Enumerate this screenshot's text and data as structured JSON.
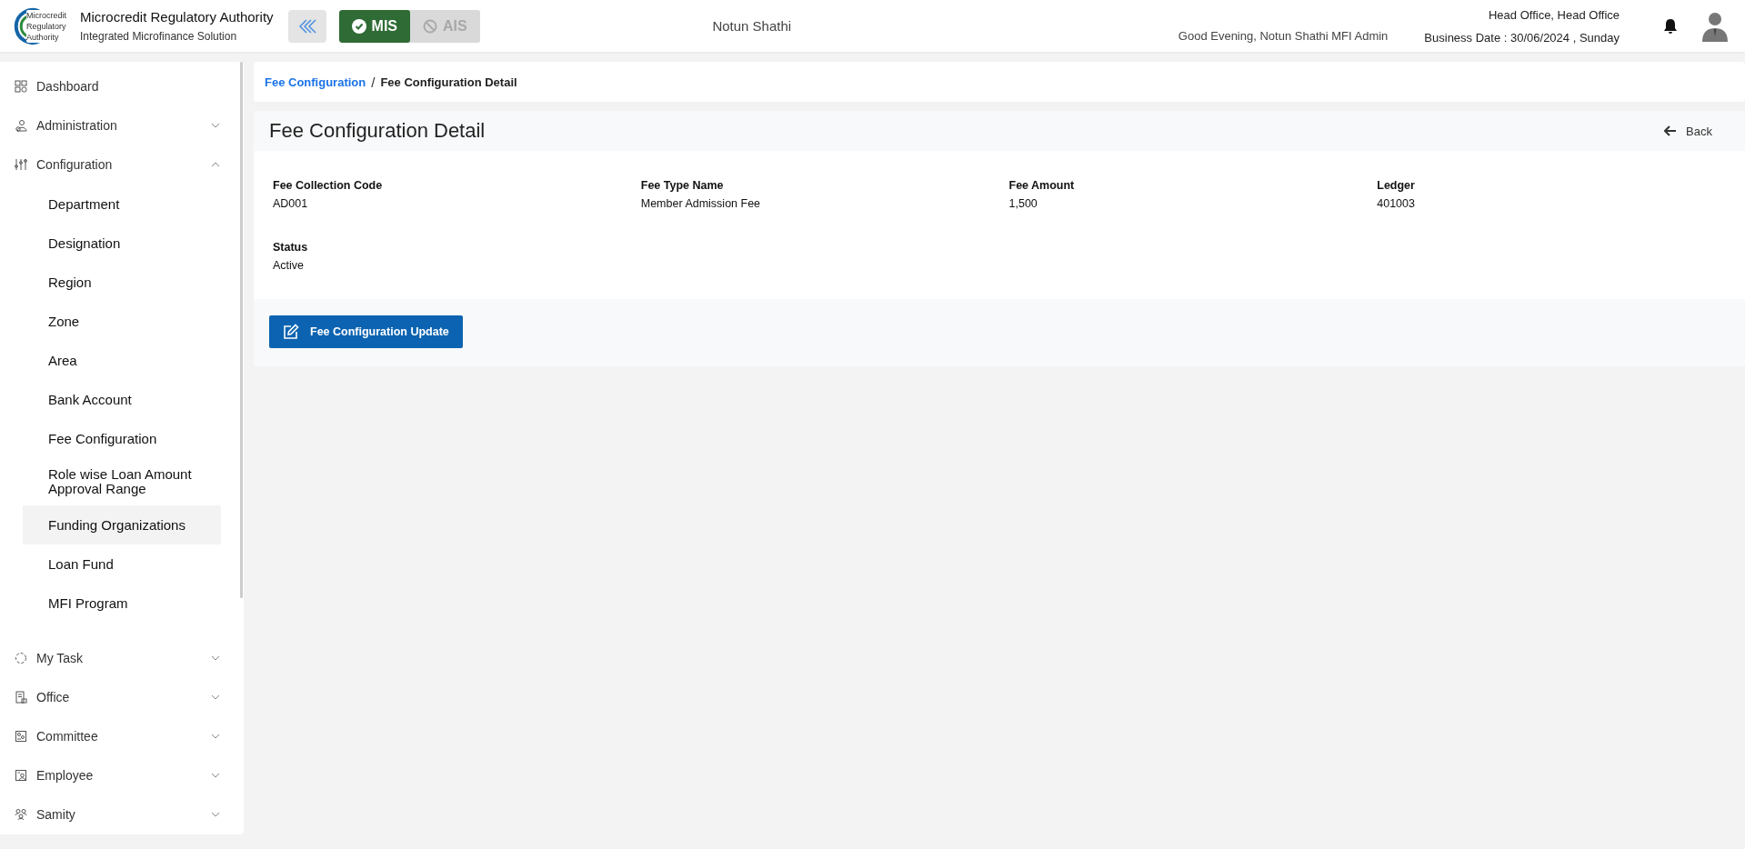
{
  "header": {
    "logo_lines": [
      "Microcredit",
      "Regulatory",
      "Authority"
    ],
    "title": "Microcredit Regulatory Authority",
    "subtitle": "Integrated Microfinance Solution",
    "modes": [
      {
        "label": "MIS",
        "selected": true
      },
      {
        "label": "AIS",
        "selected": false
      }
    ],
    "organization": "Notun Shathi",
    "greeting": "Good Evening, Notun Shathi MFI Admin",
    "office": "Head Office, Head Office",
    "business_date": "Business Date : 30/06/2024 , Sunday"
  },
  "sidebar": {
    "items": [
      {
        "label": "Dashboard",
        "kind": "link"
      },
      {
        "label": "Administration",
        "kind": "group",
        "expanded": false
      },
      {
        "label": "Configuration",
        "kind": "group",
        "expanded": true,
        "children": [
          {
            "label": "Department",
            "selected": false
          },
          {
            "label": "Designation",
            "selected": false
          },
          {
            "label": "Region",
            "selected": false
          },
          {
            "label": "Zone",
            "selected": false
          },
          {
            "label": "Area",
            "selected": false
          },
          {
            "label": "Bank Account",
            "selected": false
          },
          {
            "label": "Fee Configuration",
            "selected": false
          },
          {
            "label": "Role wise Loan Amount Approval Range",
            "selected": false
          },
          {
            "label": "Funding Organizations",
            "selected": true
          },
          {
            "label": "Loan Fund",
            "selected": false
          },
          {
            "label": "MFI Program",
            "selected": false
          }
        ]
      },
      {
        "label": "My Task",
        "kind": "group",
        "expanded": false
      },
      {
        "label": "Office",
        "kind": "group",
        "expanded": false
      },
      {
        "label": "Committee",
        "kind": "group",
        "expanded": false
      },
      {
        "label": "Employee",
        "kind": "group",
        "expanded": false
      },
      {
        "label": "Samity",
        "kind": "group",
        "expanded": false
      }
    ]
  },
  "breadcrumb": [
    {
      "label": "Fee Configuration",
      "kind": "link"
    },
    {
      "label": "/",
      "kind": "separator"
    },
    {
      "label": "Fee Configuration Detail",
      "kind": "current"
    }
  ],
  "detail": {
    "title": "Fee Configuration Detail",
    "back_label": "Back",
    "fields": [
      {
        "label": "Fee Collection Code",
        "value": "AD001"
      },
      {
        "label": "Fee Type Name",
        "value": "Member Admission Fee"
      },
      {
        "label": "Fee Amount",
        "value": "1,500"
      },
      {
        "label": "Ledger",
        "value": "401003"
      },
      {
        "label": "Status",
        "value": "Active"
      }
    ],
    "update_button": "Fee Configuration Update"
  }
}
